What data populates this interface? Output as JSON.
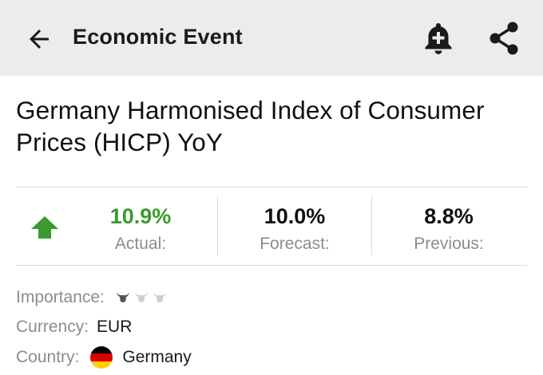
{
  "appbar": {
    "title": "Economic Event",
    "back_icon": "arrow-left-icon",
    "alert_icon": "bell-plus-icon",
    "share_icon": "share-icon"
  },
  "event": {
    "title": "Germany Harmonised Index of Consumer Prices (HICP) YoY"
  },
  "stats": {
    "trend": "up",
    "trend_color": "#3a9a2e",
    "actual": {
      "value": "10.9%",
      "label": "Actual:"
    },
    "forecast": {
      "value": "10.0%",
      "label": "Forecast:"
    },
    "previous": {
      "value": "8.8%",
      "label": "Previous:"
    }
  },
  "details": {
    "importance_label": "Importance:",
    "importance_level": 1,
    "importance_max": 3,
    "currency_label": "Currency:",
    "currency_value": "EUR",
    "country_label": "Country:",
    "country_value": "Germany",
    "country_flag_colors": [
      "#000000",
      "#dd0000",
      "#ffce00"
    ]
  }
}
